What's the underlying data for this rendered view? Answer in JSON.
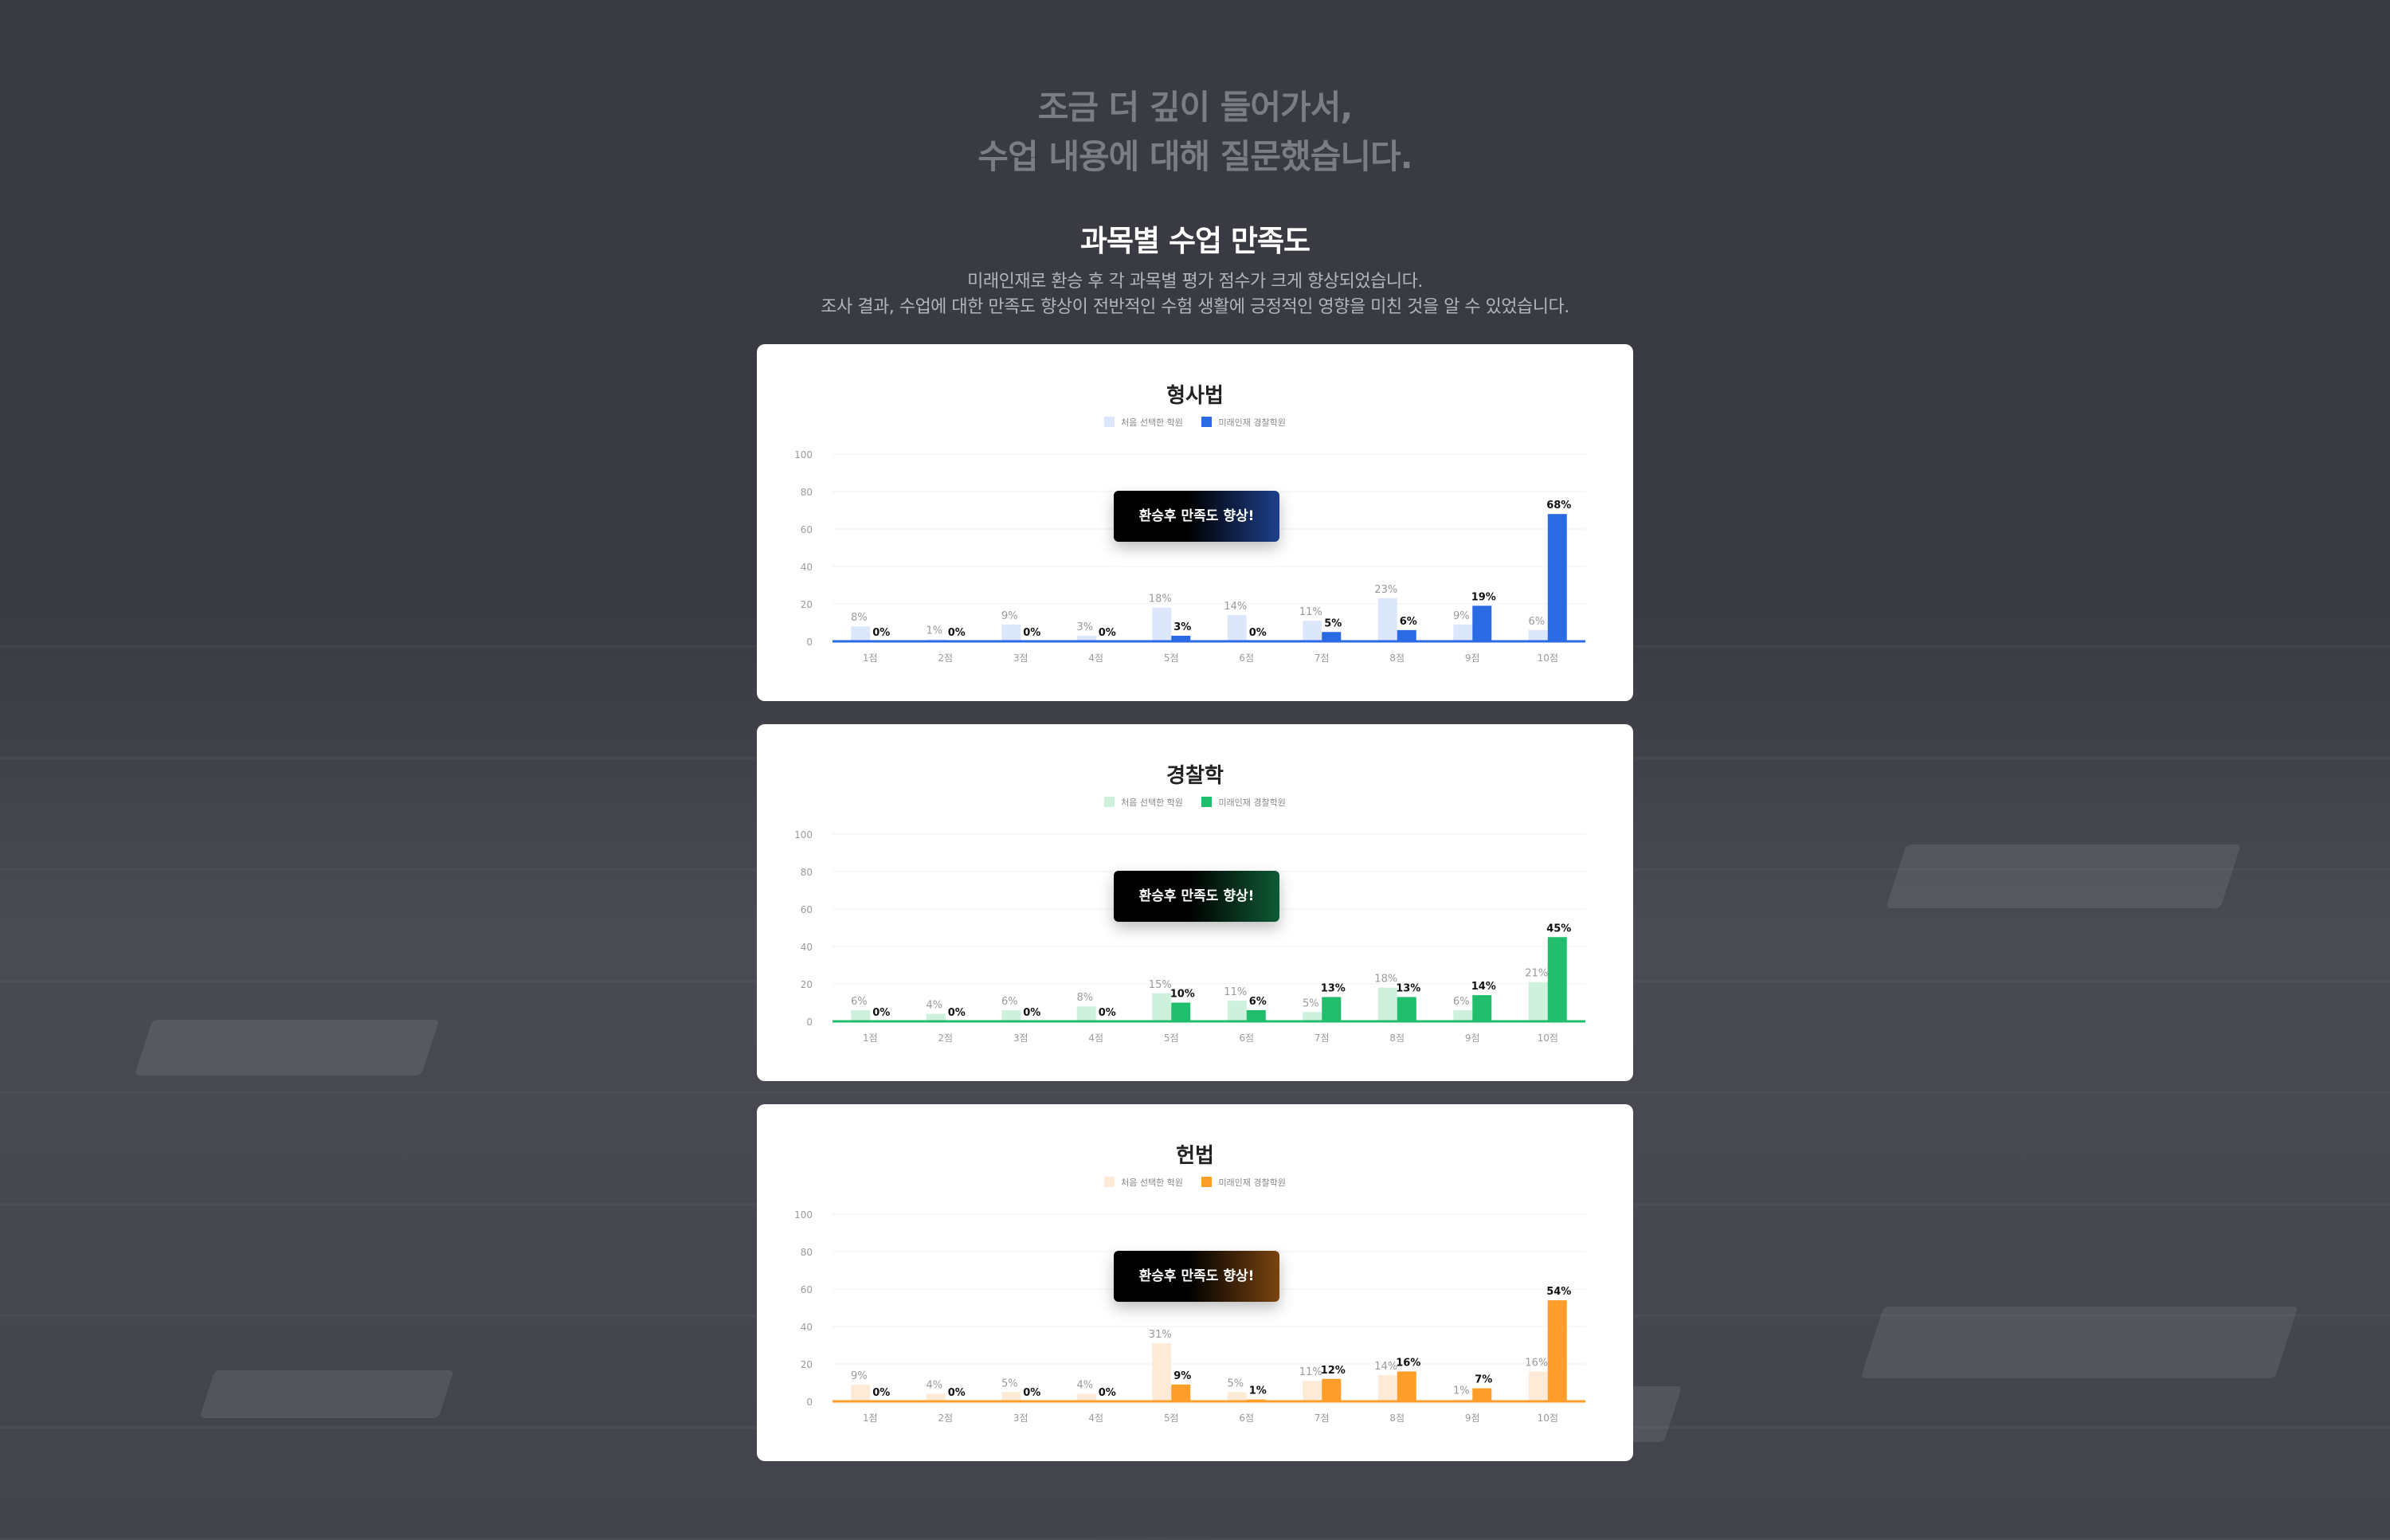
{
  "header": {
    "title_line1": "조금 더 깊이 들어가서,",
    "title_line2": "수업 내용에 대해 질문했습니다."
  },
  "section": {
    "title": "과목별 수업 만족도",
    "desc_line1": "미래인재로 환승 후 각 과목별 평가 점수가 크게 향상되었습니다.",
    "desc_line2": "조사 결과, 수업에 대한 만족도 향상이 전반적인 수험 생활에 긍정적인 영향을 미친 것을 알 수 있었습니다."
  },
  "cards": [
    {
      "title": "형사법",
      "legend_before": "처음 선택한 학원",
      "legend_after": "미래인재 경찰학원",
      "badge": "환승후 만족도 향상!",
      "color_light": "#dde7fb",
      "color_dark": "#2a6be3",
      "badge_from": "#000000",
      "badge_to": "#1d3f8a"
    },
    {
      "title": "경찰학",
      "legend_before": "처음 선택한 학원",
      "legend_after": "미래인재 경찰학원",
      "badge": "환승후 만족도 향상!",
      "color_light": "#cdf1dd",
      "color_dark": "#1fbd6c",
      "badge_from": "#000000",
      "badge_to": "#0f5a35"
    },
    {
      "title": "헌법",
      "legend_before": "처음 선택한 학원",
      "legend_after": "미래인재 경찰학원",
      "badge": "환승후 만족도 향상!",
      "color_light": "#fdebd7",
      "color_dark": "#ff9d2a",
      "badge_from": "#000000",
      "badge_to": "#7a4410"
    }
  ],
  "chart_data": [
    {
      "type": "bar",
      "title": "형사법",
      "categories": [
        "1점",
        "2점",
        "3점",
        "4점",
        "5점",
        "6점",
        "7점",
        "8점",
        "9점",
        "10점"
      ],
      "series": [
        {
          "name": "처음 선택한 학원",
          "values": [
            8,
            1,
            9,
            3,
            18,
            14,
            11,
            23,
            9,
            6
          ]
        },
        {
          "name": "미래인재 경찰학원",
          "values": [
            0,
            0,
            0,
            0,
            3,
            0,
            5,
            6,
            19,
            68
          ]
        }
      ],
      "yticks": [
        0,
        20,
        40,
        60,
        80,
        100
      ],
      "ylim": [
        0,
        100
      ],
      "grid": true,
      "legend": "top-center"
    },
    {
      "type": "bar",
      "title": "경찰학",
      "categories": [
        "1점",
        "2점",
        "3점",
        "4점",
        "5점",
        "6점",
        "7점",
        "8점",
        "9점",
        "10점"
      ],
      "series": [
        {
          "name": "처음 선택한 학원",
          "values": [
            6,
            4,
            6,
            8,
            15,
            11,
            5,
            18,
            6,
            21
          ]
        },
        {
          "name": "미래인재 경찰학원",
          "values": [
            0,
            0,
            0,
            0,
            10,
            6,
            13,
            13,
            14,
            45
          ]
        }
      ],
      "yticks": [
        0,
        20,
        40,
        60,
        80,
        100
      ],
      "ylim": [
        0,
        100
      ],
      "grid": true,
      "legend": "top-center"
    },
    {
      "type": "bar",
      "title": "헌법",
      "categories": [
        "1점",
        "2점",
        "3점",
        "4점",
        "5점",
        "6점",
        "7점",
        "8점",
        "9점",
        "10점"
      ],
      "series": [
        {
          "name": "처음 선택한 학원",
          "values": [
            9,
            4,
            5,
            4,
            31,
            5,
            11,
            14,
            1,
            16
          ]
        },
        {
          "name": "미래인재 경찰학원",
          "values": [
            0,
            0,
            0,
            0,
            9,
            1,
            12,
            16,
            7,
            54
          ]
        }
      ],
      "yticks": [
        0,
        20,
        40,
        60,
        80,
        100
      ],
      "ylim": [
        0,
        100
      ],
      "grid": true,
      "legend": "top-center"
    }
  ]
}
